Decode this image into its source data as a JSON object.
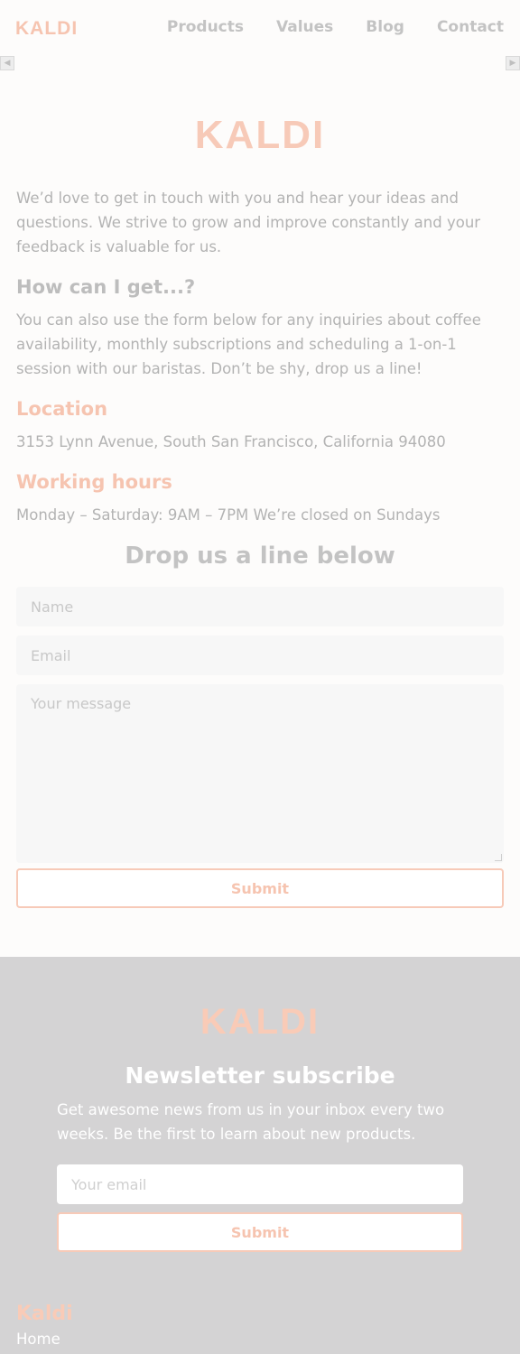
{
  "header": {
    "logo": "KALDI",
    "nav": [
      {
        "label": "Products"
      },
      {
        "label": "Values"
      },
      {
        "label": "Blog"
      },
      {
        "label": "Contact"
      }
    ],
    "scroll_left": "◀",
    "scroll_right": "▶"
  },
  "main": {
    "logo": "KALDI",
    "intro": "We’d love to get in touch with you and hear your ideas and questions. We strive to grow and improve constantly and your feedback is valuable for us.",
    "how_title": "How can I get...?",
    "how_text": "You can also use the form below for any inquiries about coffee availability, monthly subscriptions and scheduling a 1-on-1 session with our baristas. Don’t be shy, drop us a line!",
    "location_title": "Location",
    "location_text": "3153 Lynn Avenue, South San Francisco, California 94080",
    "hours_title": "Working hours",
    "hours_text": "Monday – Saturday: 9AM – 7PM We’re closed on Sundays",
    "form": {
      "title": "Drop us a line below",
      "name_placeholder": "Name",
      "email_placeholder": "Email",
      "message_placeholder": "Your message",
      "submit_label": "Submit"
    }
  },
  "footer": {
    "logo": "KALDI",
    "newsletter_title": "Newsletter subscribe",
    "newsletter_text": "Get awesome news from us in your inbox every two weeks. Be the first to learn about new products.",
    "email_placeholder": "Your email",
    "submit_label": "Submit",
    "brand": "Kaldi",
    "links": [
      {
        "label": "Home"
      }
    ]
  },
  "colors": {
    "accent": "#f6c4b0",
    "footer_bg": "#d4d3d4",
    "page_bg": "#fdfcfb"
  }
}
